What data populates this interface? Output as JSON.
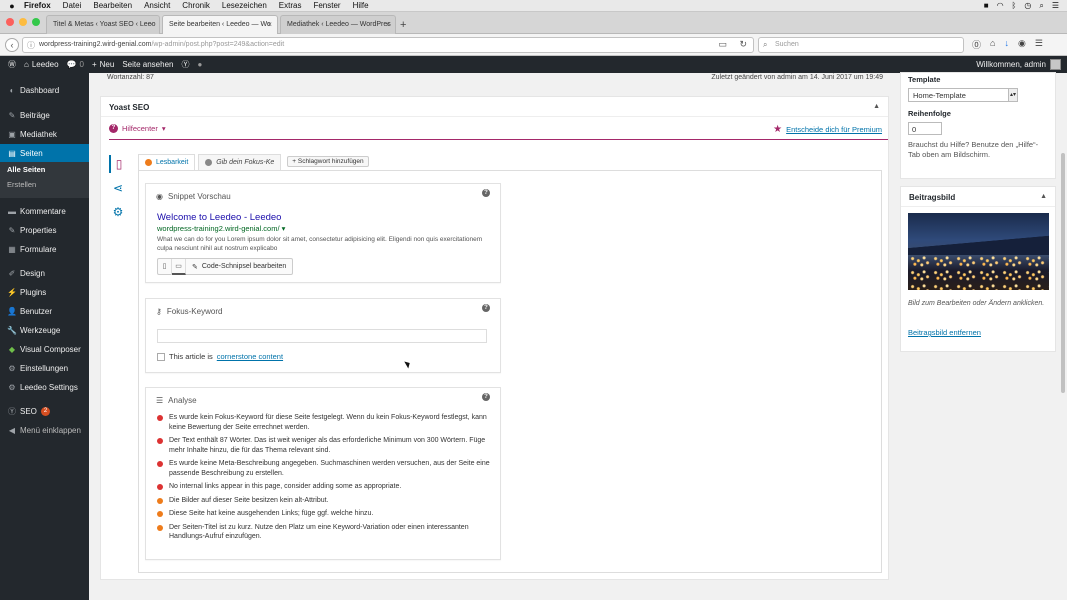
{
  "mac_menu": {
    "app": "Firefox",
    "items": [
      "Datei",
      "Bearbeiten",
      "Ansicht",
      "Chronik",
      "Lesezeichen",
      "Extras",
      "Fenster",
      "Hilfe"
    ]
  },
  "browser": {
    "tabs": [
      {
        "label": "Titel & Metas ‹ Yoast SEO ‹ Leeo"
      },
      {
        "label": "Seite bearbeiten ‹ Leedeo — Wo"
      },
      {
        "label": "Mediathek ‹ Leedeo — WordPres"
      }
    ],
    "url_main": "wordpress-training2.wird-genial.com",
    "url_rest": "/wp-admin/post.php?post=249&action=edit",
    "search_placeholder": "Suchen"
  },
  "adminbar": {
    "site": "Leedeo",
    "comments": "0",
    "new": "Neu",
    "view": "Seite ansehen",
    "welcome": "Willkommen, admin"
  },
  "sidebar": {
    "items": [
      {
        "label": "Dashboard"
      },
      {
        "label": "Beiträge"
      },
      {
        "label": "Mediathek"
      },
      {
        "label": "Seiten"
      },
      {
        "label": "Kommentare"
      },
      {
        "label": "Properties"
      },
      {
        "label": "Formulare"
      },
      {
        "label": "Design"
      },
      {
        "label": "Plugins"
      },
      {
        "label": "Benutzer"
      },
      {
        "label": "Werkzeuge"
      },
      {
        "label": "Visual Composer"
      },
      {
        "label": "Einstellungen"
      },
      {
        "label": "Leedeo Settings"
      },
      {
        "label": "SEO",
        "badge": "2"
      },
      {
        "label": "Menü einklappen"
      }
    ],
    "submenu": [
      "Alle Seiten",
      "Erstellen"
    ]
  },
  "editor": {
    "word_count": "Wortanzahl: 87",
    "last_edit": "Zuletzt geändert von admin am 14. Juni 2017 um 19:49"
  },
  "yoast": {
    "title": "Yoast SEO",
    "help_center": "Hilfecenter",
    "premium": "Entscheide dich für Premium",
    "tabs": [
      {
        "label": "Lesbarkeit",
        "color": "#ee7c1b"
      },
      {
        "label": "Gib dein Fokus-Ke",
        "color": "#888888"
      }
    ],
    "add_keyword": "+ Schlagwort hinzufügen",
    "snippet": {
      "heading": "Snippet Vorschau",
      "title": "Welcome to Leedeo - Leedeo",
      "url": "wordpress-training2.wird-genial.com/ ▾",
      "desc": "What we can do for you Lorem ipsum dolor sit amet, consectetur adipisicing elit. Eligendi non quis exercitationem culpa nesciunt nihil aut nostrum explicabo",
      "edit_button": "Code-Schnipsel bearbeiten"
    },
    "focus": {
      "heading": "Fokus-Keyword",
      "cornerstone_prefix": "This article is",
      "cornerstone_link": "cornerstone content"
    },
    "analysis": {
      "heading": "Analyse",
      "items": [
        {
          "text": "Es wurde kein Fokus-Keyword für diese Seite festgelegt. Wenn du kein Fokus-Keyword festlegst, kann keine Bewertung der Seite errechnet werden.",
          "color": "#dc3232"
        },
        {
          "text": "Der Text enthält 87 Wörter. Das ist weit weniger als das erforderliche Minimum von 300 Wörtern. Füge mehr Inhalte hinzu, die für das Thema relevant sind.",
          "color": "#dc3232"
        },
        {
          "text": "Es wurde keine Meta-Beschreibung angegeben. Suchmaschinen werden versuchen, aus der Seite eine passende Beschreibung zu erstellen.",
          "color": "#dc3232"
        },
        {
          "text": "No internal links appear in this page, consider adding some as appropriate.",
          "color": "#dc3232"
        },
        {
          "text": "Die Bilder auf dieser Seite besitzen kein alt-Attribut.",
          "color": "#ee7c1b"
        },
        {
          "text": "Diese Seite hat keine ausgehenden Links; füge ggf. welche hinzu.",
          "color": "#ee7c1b"
        },
        {
          "text": "Der Seiten-Titel ist zu kurz. Nutze den Platz um eine Keyword-Variation oder einen interessanten Handlungs-Aufruf einzufügen.",
          "color": "#ee7c1b"
        }
      ]
    }
  },
  "right": {
    "template_label": "Template",
    "template_value": "Home-Template",
    "order_label": "Reihenfolge",
    "order_value": "0",
    "help_text": "Brauchst du Hilfe? Benutze den „Hilfe“-Tab oben am Bildschirm.",
    "featured_title": "Beitragsbild",
    "featured_hint": "Bild zum Bearbeiten oder Ändern anklicken.",
    "featured_remove": "Beitragsbild entfernen"
  }
}
